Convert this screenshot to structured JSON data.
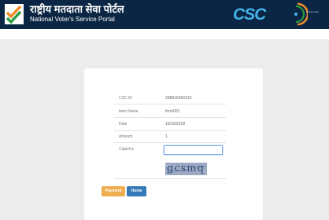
{
  "header": {
    "title_hindi": "राष्ट्रीय मतदाता सेवा पोर्टल",
    "title_english": "National Voter's Service Portal",
    "emblem_icon": "ballot-tick-icon",
    "partner_logo": "CSC",
    "digital_india_text": "Digital India",
    "colors": {
      "background": "#0b2644",
      "csc_blue": "#45b4ea",
      "tick_orange": "#f28c28",
      "tick_green": "#2f9e44"
    }
  },
  "form": {
    "rows": [
      {
        "label": "CSC ID",
        "value": "298816960316"
      },
      {
        "label": "Item Name",
        "value": "form001"
      },
      {
        "label": "Date",
        "value": "15/10/2018"
      },
      {
        "label": "Amount",
        "value": "1"
      }
    ],
    "captcha": {
      "label": "Captcha",
      "value": "",
      "placeholder": "",
      "image_text": "gcsmq"
    },
    "buttons": {
      "payment": "Payment",
      "home": "Home"
    },
    "colors": {
      "payment": "#f0ad4e",
      "home": "#337ab7"
    }
  }
}
